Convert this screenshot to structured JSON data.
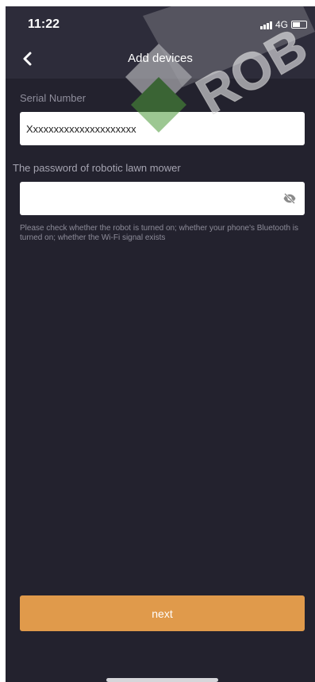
{
  "status_bar": {
    "time": "11:22",
    "network": "4G"
  },
  "header": {
    "title": "Add devices",
    "back_icon": "chevron-left-icon"
  },
  "serial_field": {
    "label": "Serial Number",
    "value": "Xxxxxxxxxxxxxxxxxxxxx"
  },
  "password_field": {
    "label": "The password of robotic lawn mower",
    "value": "",
    "toggle_icon": "eye-off-icon"
  },
  "help_text": "Please check whether the robot is turned on; whether your phone's Bluetooth is turned on; whether the Wi-Fi signal exists",
  "next_button": {
    "label": "next"
  },
  "watermark": {
    "text": "ROB"
  },
  "colors": {
    "background": "#23222e",
    "header_background": "#2d2c3a",
    "accent": "#e09a4b",
    "watermark_green": "#4d9b3a"
  }
}
